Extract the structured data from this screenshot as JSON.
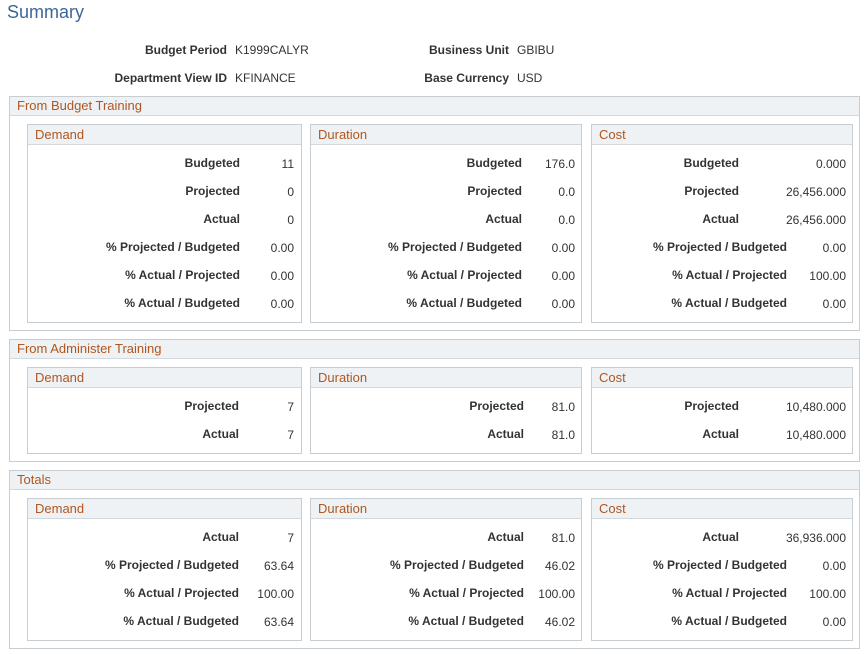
{
  "page_title": "Summary",
  "header": {
    "budget_period_label": "Budget Period",
    "budget_period_value": "K1999CALYR",
    "business_unit_label": "Business Unit",
    "business_unit_value": "GBIBU",
    "department_view_label": "Department View ID",
    "department_view_value": "KFINANCE",
    "base_currency_label": "Base Currency",
    "base_currency_value": "USD"
  },
  "sections": [
    {
      "title": "From Budget Training",
      "boxes": [
        {
          "title": "Demand",
          "rows": [
            {
              "label": "Budgeted",
              "value": "11"
            },
            {
              "label": "Projected",
              "value": "0"
            },
            {
              "label": "Actual",
              "value": "0"
            },
            {
              "label": "% Projected / Budgeted",
              "value": "0.00"
            },
            {
              "label": "% Actual / Projected",
              "value": "0.00"
            },
            {
              "label": "% Actual / Budgeted",
              "value": "0.00"
            }
          ]
        },
        {
          "title": "Duration",
          "rows": [
            {
              "label": "Budgeted",
              "value": "176.0"
            },
            {
              "label": "Projected",
              "value": "0.0"
            },
            {
              "label": "Actual",
              "value": "0.0"
            },
            {
              "label": "% Projected / Budgeted",
              "value": "0.00"
            },
            {
              "label": "% Actual / Projected",
              "value": "0.00"
            },
            {
              "label": "% Actual / Budgeted",
              "value": "0.00"
            }
          ]
        },
        {
          "title": "Cost",
          "rows": [
            {
              "label": "Budgeted",
              "value": "0.000"
            },
            {
              "label": "Projected",
              "value": "26,456.000"
            },
            {
              "label": "Actual",
              "value": "26,456.000"
            },
            {
              "label": "% Projected / Budgeted",
              "value": "0.00"
            },
            {
              "label": "% Actual / Projected",
              "value": "100.00"
            },
            {
              "label": "% Actual / Budgeted",
              "value": "0.00"
            }
          ]
        }
      ]
    },
    {
      "title": "From Administer Training",
      "boxes": [
        {
          "title": "Demand",
          "rows": [
            {
              "label": "Projected",
              "value": "7"
            },
            {
              "label": "Actual",
              "value": "7"
            }
          ]
        },
        {
          "title": "Duration",
          "rows": [
            {
              "label": "Projected",
              "value": "81.0"
            },
            {
              "label": "Actual",
              "value": "81.0"
            }
          ]
        },
        {
          "title": "Cost",
          "rows": [
            {
              "label": "Projected",
              "value": "10,480.000"
            },
            {
              "label": "Actual",
              "value": "10,480.000"
            }
          ]
        }
      ]
    },
    {
      "title": "Totals",
      "boxes": [
        {
          "title": "Demand",
          "rows": [
            {
              "label": "Actual",
              "value": "7"
            },
            {
              "label": "% Projected / Budgeted",
              "value": "63.64"
            },
            {
              "label": "% Actual / Projected",
              "value": "100.00"
            },
            {
              "label": "% Actual / Budgeted",
              "value": "63.64"
            }
          ]
        },
        {
          "title": "Duration",
          "rows": [
            {
              "label": "Actual",
              "value": "81.0"
            },
            {
              "label": "% Projected / Budgeted",
              "value": "46.02"
            },
            {
              "label": "% Actual / Projected",
              "value": "100.00"
            },
            {
              "label": "% Actual / Budgeted",
              "value": "46.02"
            }
          ]
        },
        {
          "title": "Cost",
          "rows": [
            {
              "label": "Actual",
              "value": "36,936.000"
            },
            {
              "label": "% Projected / Budgeted",
              "value": "0.00"
            },
            {
              "label": "% Actual / Projected",
              "value": "100.00"
            },
            {
              "label": "% Actual / Budgeted",
              "value": "0.00"
            }
          ]
        }
      ]
    }
  ]
}
